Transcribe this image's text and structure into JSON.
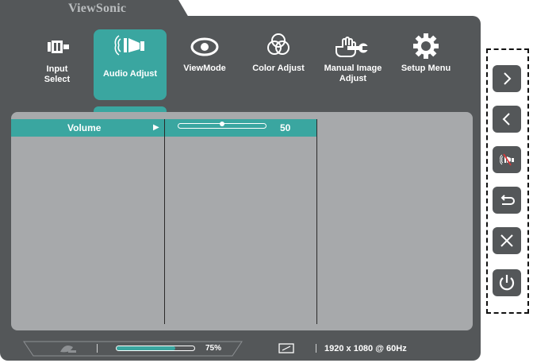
{
  "brand": "ViewSonic",
  "menu": [
    {
      "label": "Input Select",
      "icon": "input-select-icon"
    },
    {
      "label": "Audio Adjust",
      "icon": "speaker-icon",
      "active": true
    },
    {
      "label": "ViewMode",
      "icon": "eye-icon"
    },
    {
      "label": "Color Adjust",
      "icon": "color-circles-icon"
    },
    {
      "label": "Manual Image Adjust",
      "icon": "hand-wrench-icon"
    },
    {
      "label": "Setup Menu",
      "icon": "gear-icon"
    }
  ],
  "submenu": {
    "selected_item": "Volume",
    "arrow": "▶",
    "volume_value": "50",
    "volume_level": 0.5
  },
  "status_bar": {
    "progress_percent_label": "75%",
    "progress_fraction": 0.75,
    "resolution": "1920 x 1080 @ 60Hz"
  },
  "side_keys": [
    {
      "name": "next-icon"
    },
    {
      "name": "back-icon"
    },
    {
      "name": "mute-icon"
    },
    {
      "name": "return-icon"
    },
    {
      "name": "close-icon"
    },
    {
      "name": "power-icon"
    }
  ],
  "colors": {
    "frame": "#545759",
    "accent": "#3aa6a0",
    "panel": "#a7a9ab"
  }
}
